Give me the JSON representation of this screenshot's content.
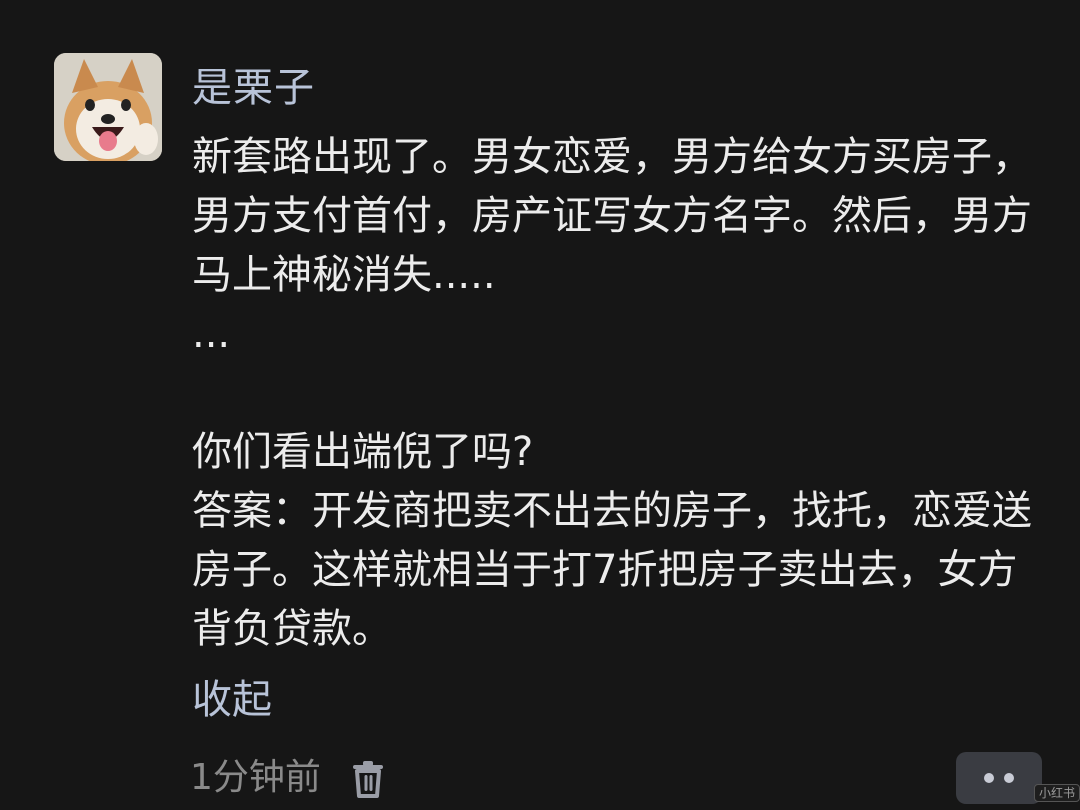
{
  "comment": {
    "username": "是栗子",
    "paragraphs": [
      "新套路出现了。男女恋爱，男方给女方买房子，男方支付首付，房产证写女方名字。然后，男方马上神秘消失.....",
      "...",
      "",
      "你们看出端倪了吗?",
      "答案：开发商把卖不出去的房子，找托，恋爱送房子。这样就相当于打7折把房子卖出去，女方背负贷款。"
    ],
    "collapse_label": "收起",
    "timestamp": "1分钟前"
  },
  "watermark": "小红书",
  "colors": {
    "background": "#161616",
    "username": "#b8c3d8",
    "text": "#ececec",
    "muted": "#8a8a8a"
  },
  "icons": {
    "avatar": "shiba-dog-avatar",
    "delete": "trash-icon",
    "more": "more-dots-icon"
  }
}
